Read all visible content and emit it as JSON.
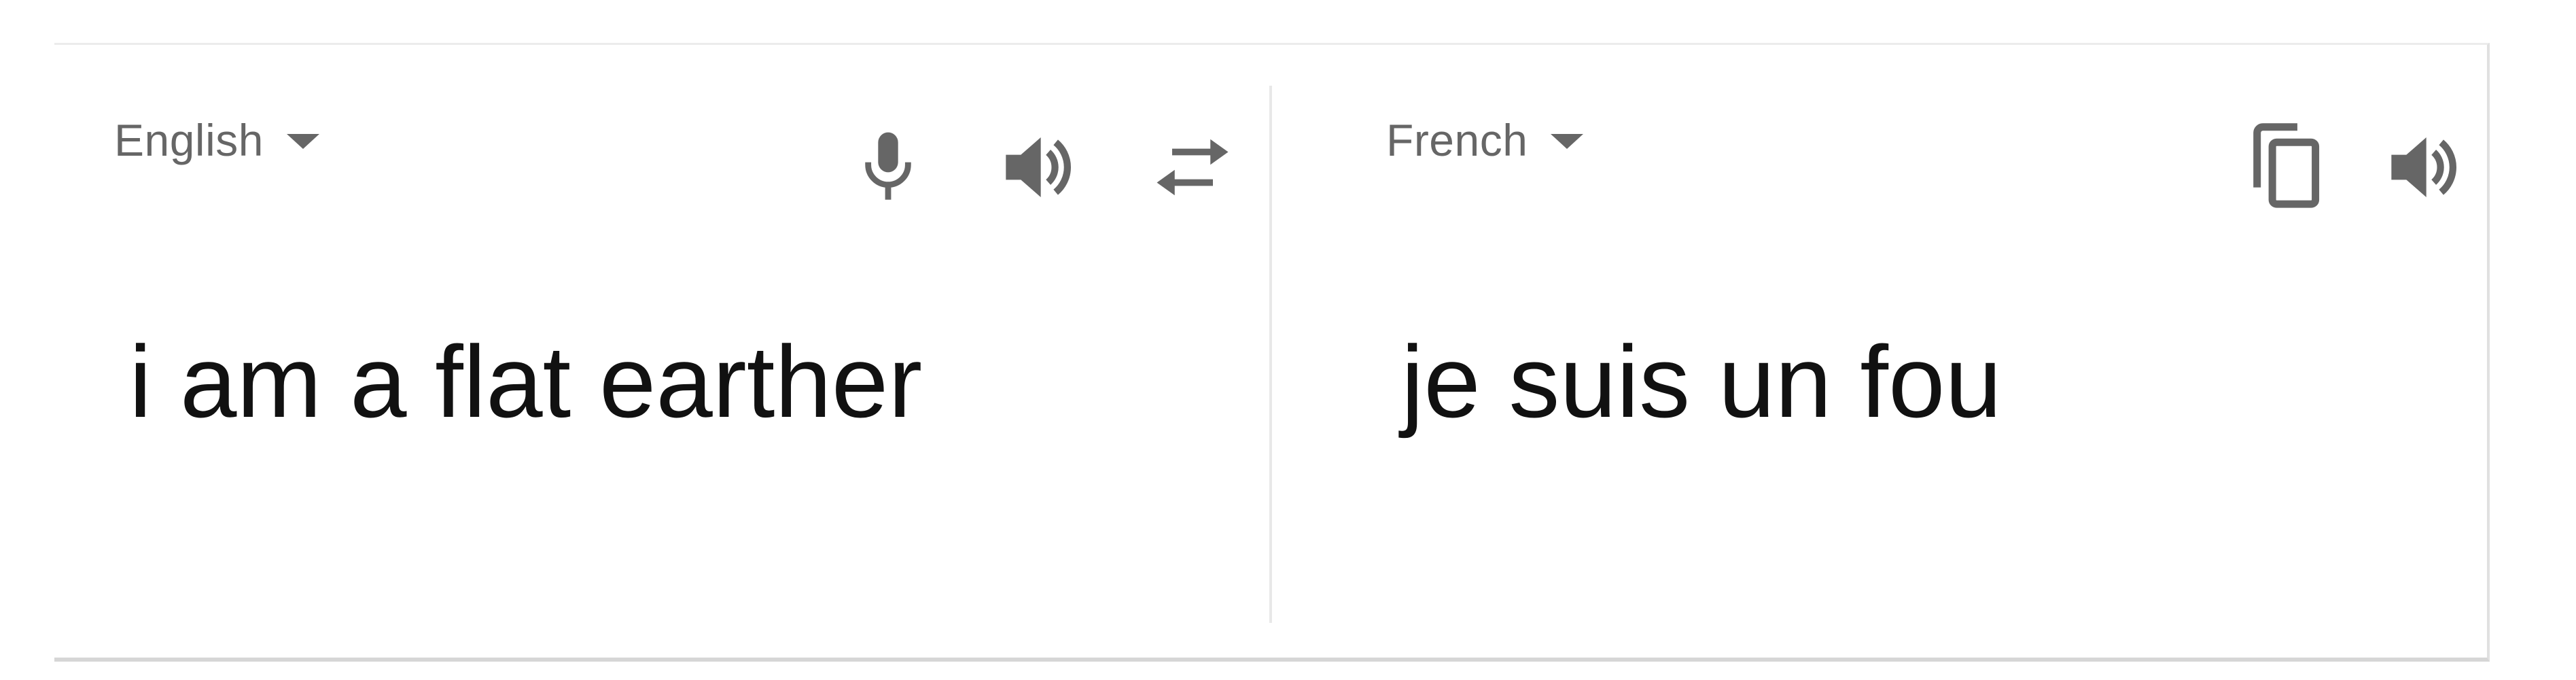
{
  "source": {
    "language": "English",
    "text": "i am a flat earther"
  },
  "target": {
    "language": "French",
    "text": "je suis un fou"
  },
  "icons": {
    "microphone": "microphone-icon",
    "speaker": "speaker-icon",
    "swap": "swap-languages-icon",
    "copy": "copy-icon"
  },
  "colors": {
    "icon": "#666666",
    "text": "#111111"
  }
}
